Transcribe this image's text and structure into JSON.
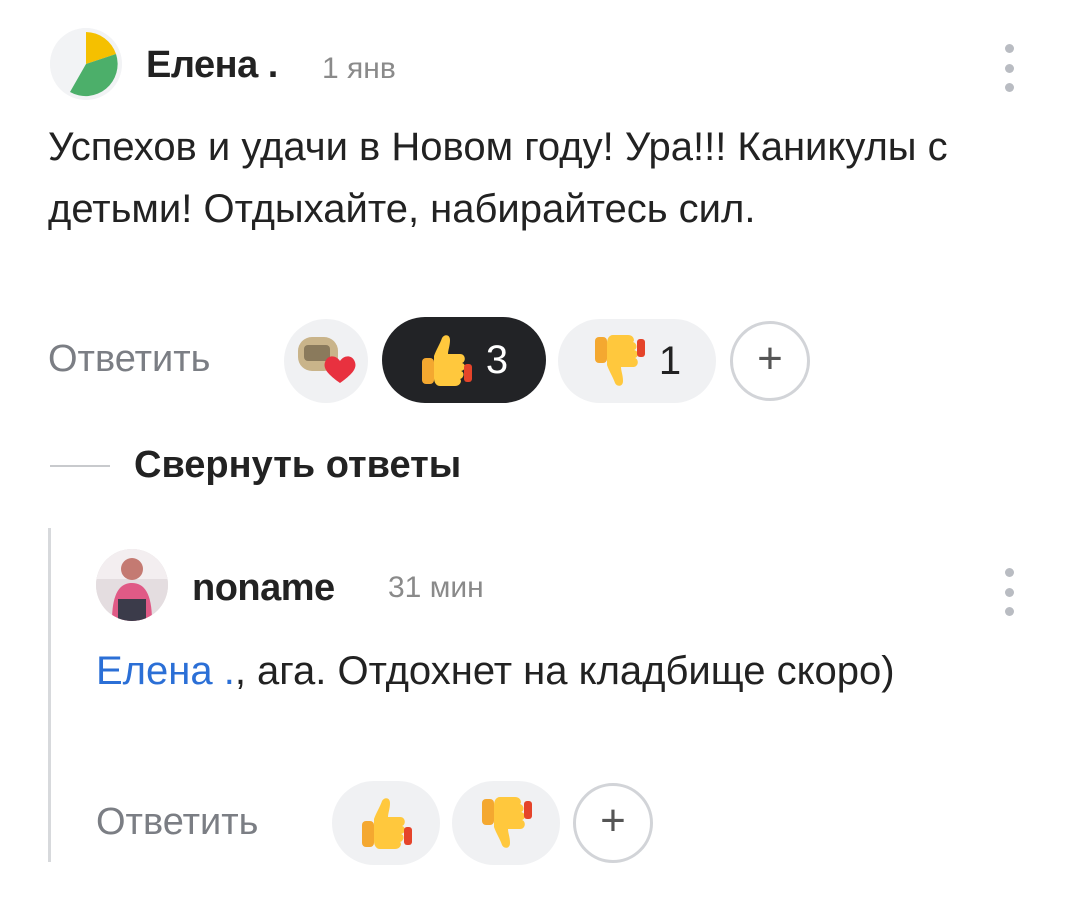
{
  "comment": {
    "author": "Елена .",
    "time": "1 янв",
    "text": "Успехов и удачи в Новом году! Ура!!! Каникулы с детьми! Отдыхайте, набирайтесь сил.",
    "reply_label": "Ответить",
    "likes_count": "3",
    "dislikes_count": "1",
    "add_reaction_label": "+"
  },
  "replies_toggle": {
    "label": "Свернуть ответы"
  },
  "reply": {
    "author": "noname",
    "time": "31 мин",
    "mention": "Елена .",
    "text": ", ага. Отдохнет на кладбище скоро)",
    "reply_label": "Ответить",
    "add_reaction_label": "+"
  },
  "colors": {
    "mention": "#2b6fd6",
    "dark_pill": "#222326",
    "pill": "#f0f1f3"
  },
  "icons": [
    "more-vertical-icon",
    "thumbs-up-icon",
    "thumbs-down-icon",
    "heart-icon",
    "plus-icon"
  ]
}
